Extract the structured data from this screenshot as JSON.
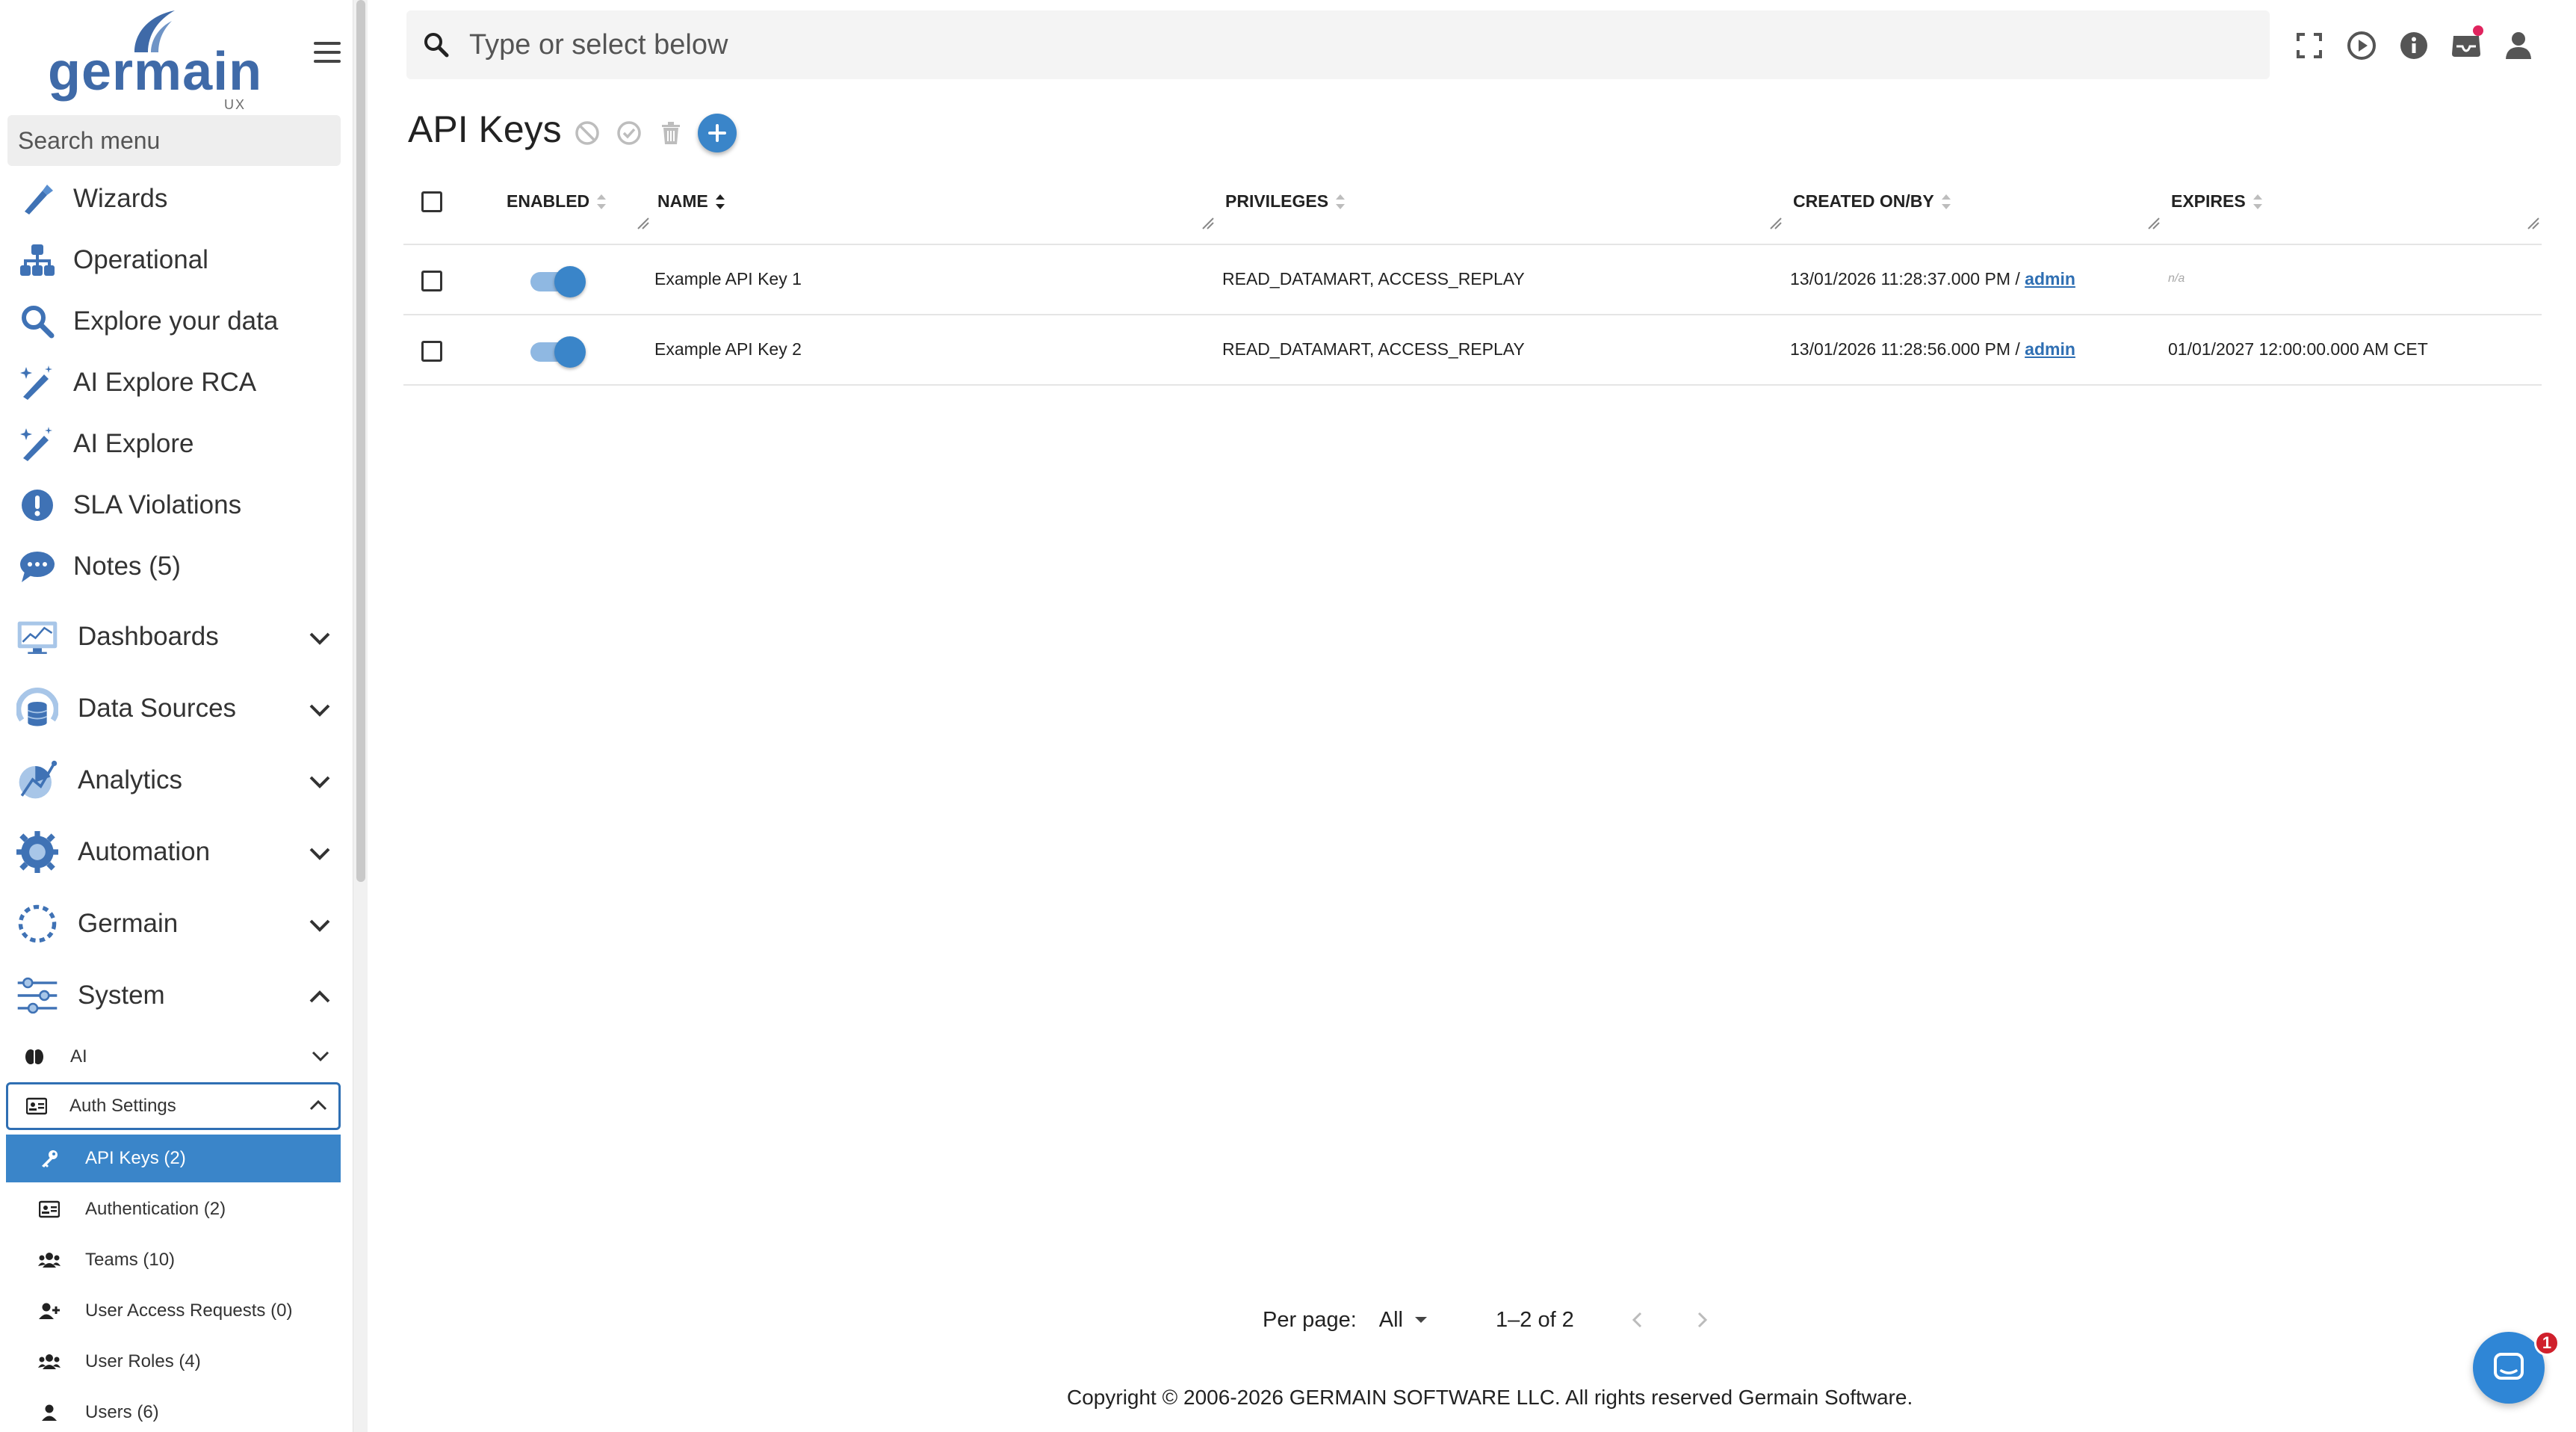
{
  "app": {
    "logo_text": "germain",
    "logo_sub": "UX",
    "brand_color": "#3f6aa8",
    "accent_color": "#3a85c9"
  },
  "sidebar": {
    "search_placeholder": "Search menu",
    "items": [
      {
        "label": "Wizards",
        "icon": "wand-icon"
      },
      {
        "label": "Operational",
        "icon": "hierarchy-icon"
      },
      {
        "label": "Explore your data",
        "icon": "search-icon"
      },
      {
        "label": "AI Explore RCA",
        "icon": "magic-wand-icon"
      },
      {
        "label": "AI Explore",
        "icon": "magic-wand-icon"
      },
      {
        "label": "SLA Violations",
        "icon": "alert-circle-icon"
      },
      {
        "label": "Notes (5)",
        "icon": "chat-bubble-icon"
      }
    ],
    "sections": [
      {
        "label": "Dashboards",
        "icon": "dashboard-icon",
        "expanded": false
      },
      {
        "label": "Data Sources",
        "icon": "data-source-icon",
        "expanded": false
      },
      {
        "label": "Analytics",
        "icon": "analytics-icon",
        "expanded": false
      },
      {
        "label": "Automation",
        "icon": "gear-icon",
        "expanded": false
      },
      {
        "label": "Germain",
        "icon": "germain-circle-icon",
        "expanded": false
      },
      {
        "label": "System",
        "icon": "sliders-icon",
        "expanded": true
      }
    ],
    "system_children": [
      {
        "label": "AI",
        "icon": "brain-icon",
        "expanded": false
      },
      {
        "label": "Auth Settings",
        "icon": "id-card-icon",
        "expanded": true
      }
    ],
    "auth_children": [
      {
        "label": "API Keys",
        "count": "(2)",
        "icon": "key-icon",
        "active": true
      },
      {
        "label": "Authentication",
        "count": "(2)",
        "icon": "id-card-icon",
        "active": false
      },
      {
        "label": "Teams",
        "count": "(10)",
        "icon": "users-icon",
        "active": false
      },
      {
        "label": "User Access Requests",
        "count": "(0)",
        "icon": "user-plus-icon",
        "active": false
      },
      {
        "label": "User Roles",
        "count": "(4)",
        "icon": "users-icon",
        "active": false
      },
      {
        "label": "Users",
        "count": "(6)",
        "icon": "user-icon",
        "active": false
      }
    ]
  },
  "topbar": {
    "search_placeholder": "Type or select below",
    "icons": [
      "fullscreen-icon",
      "play-circle-icon",
      "info-icon",
      "inbox-icon",
      "user-icon"
    ]
  },
  "page": {
    "title": "API Keys",
    "actions": [
      "disable-icon",
      "enable-icon",
      "trash-icon",
      "add-icon"
    ]
  },
  "table": {
    "columns": [
      "ENABLED",
      "NAME",
      "PRIVILEGES",
      "CREATED ON/BY",
      "EXPIRES"
    ],
    "rows": [
      {
        "enabled": true,
        "name": "Example API Key 1",
        "privileges": "READ_DATAMART, ACCESS_REPLAY",
        "created_on": "13/01/2026 11:28:37.000 PM /",
        "created_by": "admin",
        "expires": "n/a"
      },
      {
        "enabled": true,
        "name": "Example API Key 2",
        "privileges": "READ_DATAMART, ACCESS_REPLAY",
        "created_on": "13/01/2026 11:28:56.000 PM /",
        "created_by": "admin",
        "expires": "01/01/2027 12:00:00.000 AM CET"
      }
    ]
  },
  "pagination": {
    "per_page_label": "Per page:",
    "per_page_value": "All",
    "range": "1–2 of 2"
  },
  "footer": {
    "copyright": "Copyright © 2006-2026 GERMAIN SOFTWARE LLC. All rights reserved Germain Software."
  },
  "chat": {
    "badge": "1"
  }
}
